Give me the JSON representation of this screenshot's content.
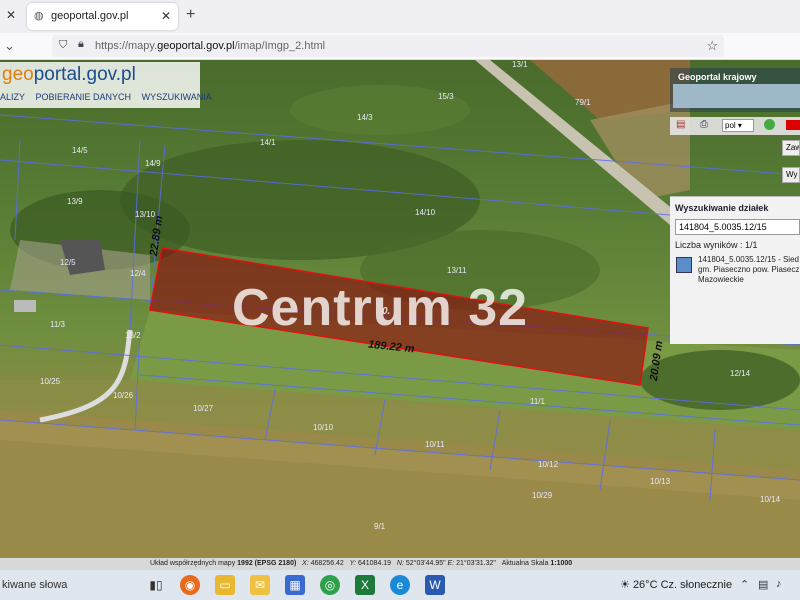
{
  "browser": {
    "tab_title": "geoportal.gov.pl",
    "url_prefix": "https://mapy.",
    "url_domain": "geoportal.gov.pl",
    "url_path": "/imap/Imgp_2.html"
  },
  "map": {
    "logo_prefix": "geo",
    "logo_mid": "portal",
    "logo_suffix": ".gov.pl",
    "menu": [
      "ALIZY",
      "POBIERANIE DANYCH",
      "WYSZUKIWANIA"
    ],
    "watermark": "Centrum 32",
    "parcel_labels": [
      "13/1",
      "79/1",
      "15/3",
      "14/1",
      "14/3",
      "14/5",
      "14/9",
      "13/9",
      "13/10",
      "14/10",
      "13/11",
      "12/5",
      "12/4",
      "11/3",
      "13/2",
      "10/25",
      "10/26",
      "10/27",
      "10/10",
      "10/11",
      "11/1",
      "10/12",
      "10/13",
      "10/29",
      "10/14",
      "12/14",
      "9/1",
      "5/1"
    ],
    "dim_left": "22.89 m",
    "dim_bottom": "189.22 m",
    "dim_right": "20.09 m",
    "parcel_center": "0."
  },
  "panel": {
    "geoportal_krajowy": "Geoportal krajowy",
    "lang": "pol",
    "btn_zaw": "Zaw",
    "btn_wy": "Wy",
    "search_title": "Wyszukiwanie działek",
    "search_value": "141804_5.0035.12/15",
    "result_count": "Liczba wyników : 1/1",
    "result_line1": "141804_5.0035.12/15 - Sied",
    "result_line2": "gm. Piaseczno pow. Piasecz",
    "result_line3": "Mazowieckie"
  },
  "status": {
    "coord_label": "Układ współrzędnych mapy",
    "coord_system": "1992 (EPSG 2180)",
    "x_label": "X:",
    "x_value": "468256.42",
    "y_label": "Y:",
    "y_value": "641084.19",
    "n_label": "N:",
    "n_value": "52°03'44.95\"",
    "e_label": "E:",
    "e_value": "21°03'31.32\"",
    "scale_label": "Aktualna Skala",
    "scale_value": "1:1000"
  },
  "taskbar": {
    "search_text": "kiwane słowa",
    "weather": "26°C  Cz. słonecznie"
  }
}
